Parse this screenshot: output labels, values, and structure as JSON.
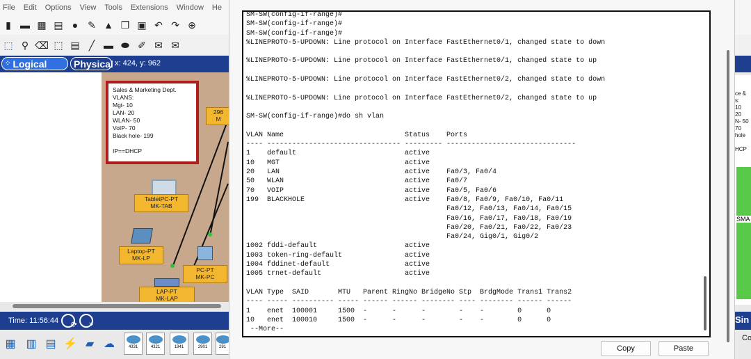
{
  "menubar": {
    "items": [
      "File",
      "Edit",
      "Options",
      "View",
      "Tools",
      "Extensions",
      "Window",
      "He"
    ]
  },
  "toolbar": {
    "icons": [
      "new-icon",
      "open-icon",
      "save-icon",
      "print-icon",
      "info-icon",
      "wizard-icon",
      "activity-icon",
      "copy-icon",
      "paste-icon",
      "undo-icon",
      "redo-icon",
      "zoom-in-icon"
    ],
    "tools": [
      "select-icon",
      "inspect-icon",
      "delete-icon",
      "resize-icon",
      "note-icon",
      "line-icon",
      "rectangle-icon",
      "ellipse-icon",
      "freehand-icon",
      "simple-pdu-icon",
      "complex-pdu-icon"
    ]
  },
  "modebar": {
    "logical": "Logical",
    "physical": "Physical",
    "coords": "x: 424, y: 962"
  },
  "workspace": {
    "note_lines": [
      "Sales & Marketing Dept.",
      "VLANS:",
      "Mgt- 10",
      "LAN- 20",
      "WLAN- 50",
      "VoIP- 70",
      "Black hole- 199",
      "",
      "IP==DHCP"
    ],
    "devices": {
      "switch": "296\nM",
      "tablet": "TabletPC-PT\nMK-TAB",
      "laptop": "Laptop-PT\nMK-LP",
      "pc": "PC-PT\nMK-PC",
      "lap": "LAP-PT\nMK-LAP"
    }
  },
  "timebar": {
    "time": "Time: 11:56:44"
  },
  "device_bar": {
    "models": [
      "4331",
      "4321",
      "1941",
      "2901",
      "291"
    ]
  },
  "right_peek": {
    "lines": [
      "ce &",
      "s:",
      "10",
      "20",
      "N- 50",
      "70",
      "hole",
      "",
      "HCP"
    ],
    "labels": [
      "SMA",
      "Sin",
      "Co"
    ]
  },
  "terminal": {
    "lines": [
      "SM-SW(config-if-range)#",
      "SM-SW(config-if-range)#",
      "SM-SW(config-if-range)#",
      "%LINEPROTO-5-UPDOWN: Line protocol on Interface FastEthernet0/1, changed state to down",
      "",
      "%LINEPROTO-5-UPDOWN: Line protocol on Interface FastEthernet0/1, changed state to up",
      "",
      "%LINEPROTO-5-UPDOWN: Line protocol on Interface FastEthernet0/2, changed state to down",
      "",
      "%LINEPROTO-5-UPDOWN: Line protocol on Interface FastEthernet0/2, changed state to up",
      "",
      "SM-SW(config-if-range)#do sh vlan",
      "",
      "VLAN Name                             Status    Ports",
      "---- -------------------------------- --------- -------------------------------",
      "1    default                          active",
      "10   MGT                              active",
      "20   LAN                              active    Fa0/3, Fa0/4",
      "50   WLAN                             active    Fa0/7",
      "70   VOIP                             active    Fa0/5, Fa0/6",
      "199  BLACKHOLE                        active    Fa0/8, Fa0/9, Fa0/10, Fa0/11",
      "                                                Fa0/12, Fa0/13, Fa0/14, Fa0/15",
      "                                                Fa0/16, Fa0/17, Fa0/18, Fa0/19",
      "                                                Fa0/20, Fa0/21, Fa0/22, Fa0/23",
      "                                                Fa0/24, Gig0/1, Gig0/2",
      "1002 fddi-default                     active",
      "1003 token-ring-default               active",
      "1004 fddinet-default                  active",
      "1005 trnet-default                    active",
      "",
      "VLAN Type  SAID       MTU   Parent RingNo BridgeNo Stp  BrdgMode Trans1 Trans2",
      "---- ----- ---------- ----- ------ ------ -------- ---- -------- ------ ------",
      "1    enet  100001     1500  -      -      -        -    -        0      0",
      "10   enet  100010     1500  -      -      -        -    -        0      0",
      " --More--"
    ]
  },
  "buttons": {
    "copy": "Copy",
    "paste": "Paste"
  }
}
